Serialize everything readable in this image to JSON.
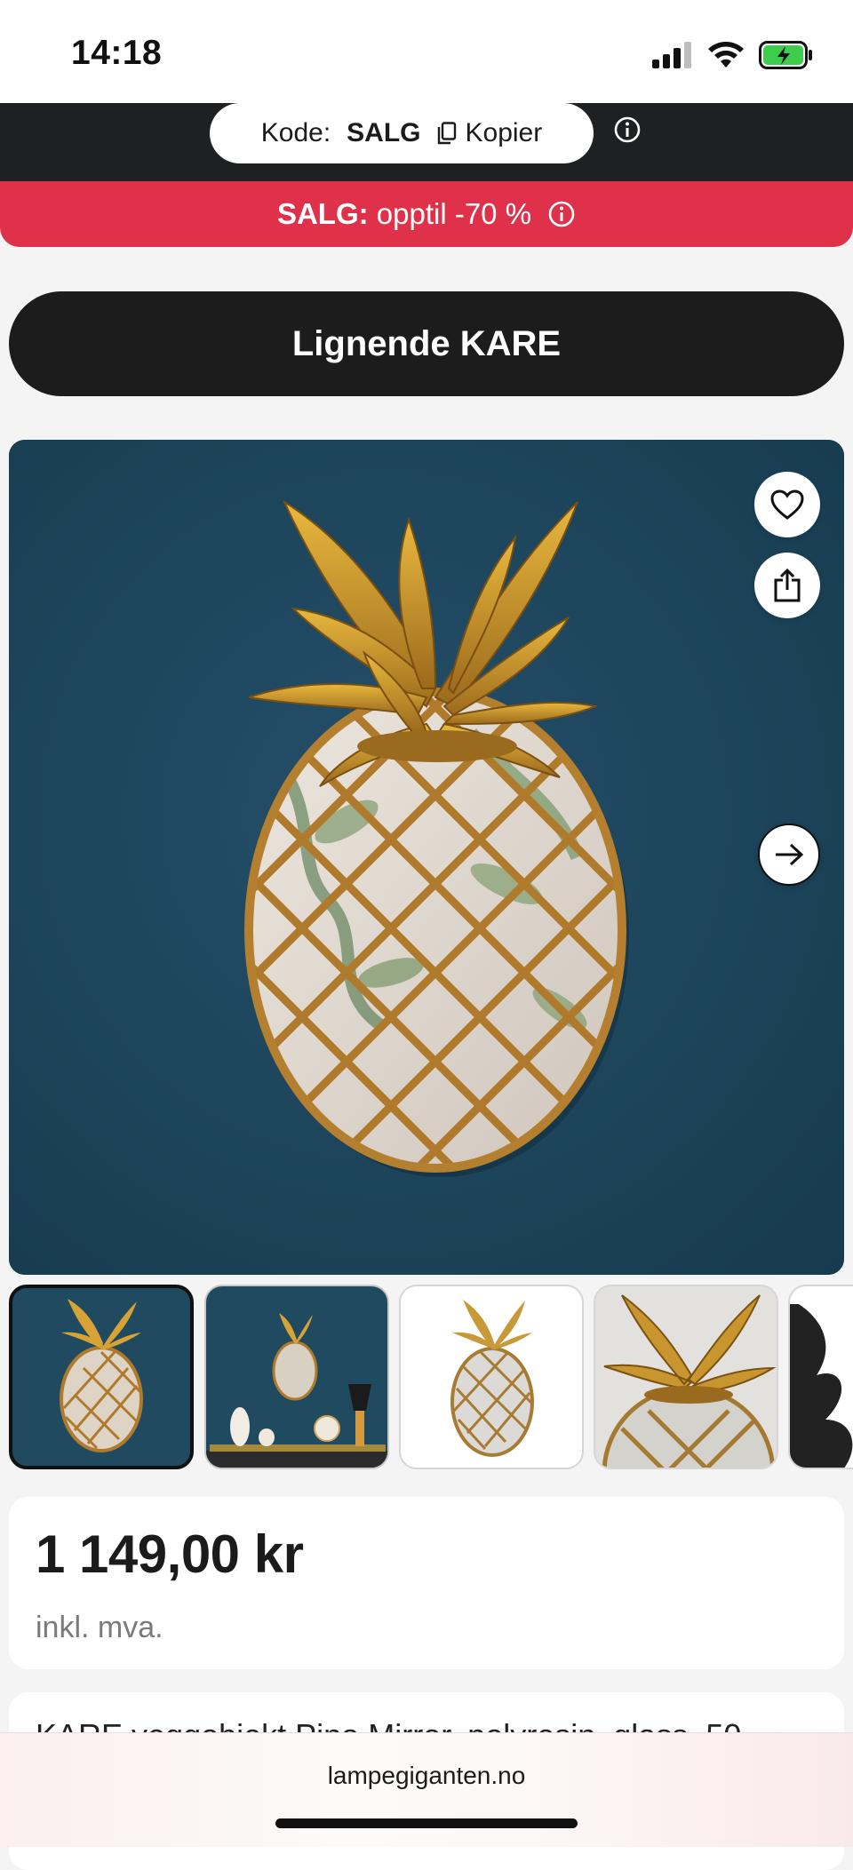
{
  "status_bar": {
    "time": "14:18",
    "icons": [
      "cellular-signal-icon",
      "wifi-icon",
      "battery-charging-icon"
    ]
  },
  "promo": {
    "code_label": "Kode:",
    "code_value": "SALG",
    "copy_label": "Kopier"
  },
  "sale_banner": {
    "prefix": "SALG:",
    "text": "opptil -70 %"
  },
  "similar_button": {
    "label": "Lignende KARE"
  },
  "gallery": {
    "main_image": "pineapple-mirror-photo",
    "actions": [
      "heart-icon",
      "share-icon",
      "arrow-right-icon"
    ],
    "thumbnails": [
      {
        "name": "thumb-1",
        "selected": true
      },
      {
        "name": "thumb-2",
        "selected": false
      },
      {
        "name": "thumb-3",
        "selected": false
      },
      {
        "name": "thumb-4",
        "selected": false
      },
      {
        "name": "thumb-5",
        "selected": false
      }
    ]
  },
  "price": {
    "amount": "1 149,00 kr",
    "vat_note": "inkl. mva."
  },
  "product": {
    "title": "KARE veggobjekt Pina Mirror, polyresin, glass, 50"
  },
  "browser": {
    "url": "lampegiganten.no"
  },
  "colors": {
    "promo_bg": "#1f2021",
    "sale_red": "#df324a",
    "button_dark": "#1c1c1c",
    "image_bg": "#1d4459",
    "gold": "#c8952f"
  }
}
